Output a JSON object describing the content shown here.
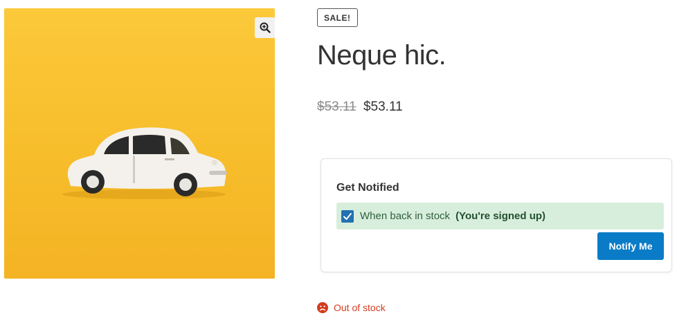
{
  "product": {
    "badge": "SALE!",
    "title": "Neque hic.",
    "price_old": "$53.11",
    "price_new": "$53.11",
    "image_icon": "car-photo",
    "zoom_icon": "magnifier-zoom-icon"
  },
  "notify": {
    "title": "Get Notified",
    "option_label": "When back in stock",
    "status": "(You're signed up)",
    "checked": true,
    "button": "Notify Me"
  },
  "stock": {
    "label": "Out of stock",
    "icon": "sad-face-icon"
  },
  "colors": {
    "accent": "#0a7cc7",
    "checkbox": "#2271b1",
    "success_bg": "#d8eedd",
    "out_of_stock": "#d23c1f",
    "image_bg": "#f7bd2b"
  }
}
